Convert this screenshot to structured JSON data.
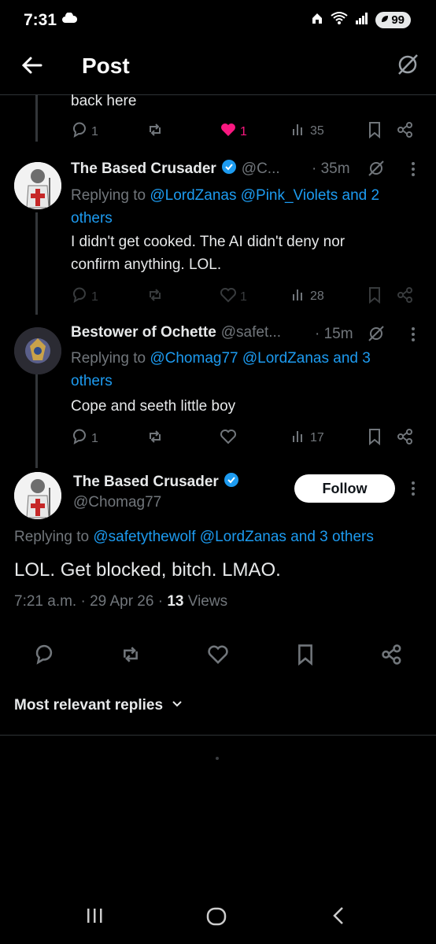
{
  "status_bar": {
    "time": "7:31",
    "battery": "99"
  },
  "header": {
    "title": "Post"
  },
  "tweet0": {
    "text_tail": "back here",
    "replies": "1",
    "likes": "1",
    "views": "35"
  },
  "tweet1": {
    "name": "The Based Crusader",
    "handle": "@C...",
    "time": "· 35m",
    "replying_label": "Replying to",
    "replying_line1": "@LordZanas @Pink_Violets and 2",
    "replying_line2": "others",
    "text_line1": "I didn't get cooked. The AI didn't deny nor",
    "text_line2": "confirm anything. LOL.",
    "replies": "1",
    "likes": "1",
    "views": "28"
  },
  "tweet2": {
    "name": "Bestower of Ochette",
    "handle": "@safet...",
    "time": "· 15m",
    "replying_label": "Replying to",
    "replying_line1": "@Chomag77 @LordZanas and 3",
    "replying_line2": "others",
    "text": "Cope and seeth little boy",
    "replies": "1",
    "views": "17"
  },
  "main": {
    "name": "The Based Crusader",
    "handle": "@Chomag77",
    "follow_label": "Follow",
    "replying_label": "Replying to",
    "replying_targets": "@safetythewolf @LordZanas and 3 others",
    "text": "LOL. Get blocked, bitch. LMAO.",
    "datetime": "7:21 a.m. · 29 Apr 26 ·",
    "views_count": "13",
    "views_label": "Views"
  },
  "sort": {
    "label": "Most relevant replies"
  },
  "colors": {
    "accent": "#1d9bf0",
    "like": "#f91880",
    "muted": "#71767b"
  }
}
